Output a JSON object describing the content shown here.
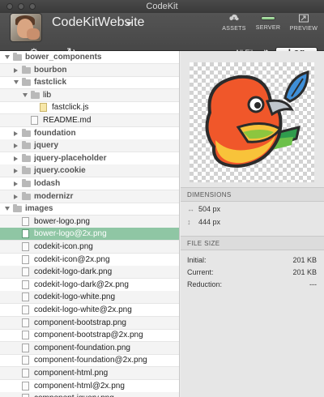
{
  "window": {
    "title": "CodeKit"
  },
  "header": {
    "project_name": "CodeKitWebsite",
    "assets_label": "ASSETS",
    "server_label": "SERVER",
    "preview_label": "PREVIEW",
    "filter_label": "All Files",
    "log_label": "Log"
  },
  "tree": {
    "rows": [
      {
        "label": "bower_components",
        "kind": "folder",
        "state": "open",
        "depth": 0,
        "bold": true
      },
      {
        "label": "bourbon",
        "kind": "folder",
        "state": "closed",
        "depth": 1,
        "bold": true
      },
      {
        "label": "fastclick",
        "kind": "folder",
        "state": "open",
        "depth": 1,
        "bold": true
      },
      {
        "label": "lib",
        "kind": "folder",
        "state": "open",
        "depth": 2,
        "bold": false
      },
      {
        "label": "fastclick.js",
        "kind": "js",
        "depth": 3,
        "bold": false
      },
      {
        "label": "README.md",
        "kind": "file",
        "depth": 2,
        "bold": false
      },
      {
        "label": "foundation",
        "kind": "folder",
        "state": "closed",
        "depth": 1,
        "bold": true
      },
      {
        "label": "jquery",
        "kind": "folder",
        "state": "closed",
        "depth": 1,
        "bold": true
      },
      {
        "label": "jquery-placeholder",
        "kind": "folder",
        "state": "closed",
        "depth": 1,
        "bold": true
      },
      {
        "label": "jquery.cookie",
        "kind": "folder",
        "state": "closed",
        "depth": 1,
        "bold": true
      },
      {
        "label": "lodash",
        "kind": "folder",
        "state": "closed",
        "depth": 1,
        "bold": true
      },
      {
        "label": "modernizr",
        "kind": "folder",
        "state": "closed",
        "depth": 1,
        "bold": true
      },
      {
        "label": "images",
        "kind": "folder",
        "state": "open",
        "depth": 0,
        "bold": true
      },
      {
        "label": "bower-logo.png",
        "kind": "file",
        "depth": 1,
        "bold": false
      },
      {
        "label": "bower-logo@2x.png",
        "kind": "file",
        "depth": 1,
        "bold": false,
        "selected": true
      },
      {
        "label": "codekit-icon.png",
        "kind": "file",
        "depth": 1,
        "bold": false
      },
      {
        "label": "codekit-icon@2x.png",
        "kind": "file",
        "depth": 1,
        "bold": false
      },
      {
        "label": "codekit-logo-dark.png",
        "kind": "file",
        "depth": 1,
        "bold": false
      },
      {
        "label": "codekit-logo-dark@2x.png",
        "kind": "file",
        "depth": 1,
        "bold": false
      },
      {
        "label": "codekit-logo-white.png",
        "kind": "file",
        "depth": 1,
        "bold": false
      },
      {
        "label": "codekit-logo-white@2x.png",
        "kind": "file",
        "depth": 1,
        "bold": false
      },
      {
        "label": "component-bootstrap.png",
        "kind": "file",
        "depth": 1,
        "bold": false
      },
      {
        "label": "component-bootstrap@2x.png",
        "kind": "file",
        "depth": 1,
        "bold": false
      },
      {
        "label": "component-foundation.png",
        "kind": "file",
        "depth": 1,
        "bold": false
      },
      {
        "label": "component-foundation@2x.png",
        "kind": "file",
        "depth": 1,
        "bold": false
      },
      {
        "label": "component-html.png",
        "kind": "file",
        "depth": 1,
        "bold": false
      },
      {
        "label": "component-html@2x.png",
        "kind": "file",
        "depth": 1,
        "bold": false
      },
      {
        "label": "component-jquery.png",
        "kind": "file",
        "depth": 1,
        "bold": false
      }
    ]
  },
  "inspector": {
    "dimensions_title": "DIMENSIONS",
    "width": "504 px",
    "height": "444 px",
    "filesize_title": "FILE SIZE",
    "initial_label": "Initial:",
    "initial_value": "201 KB",
    "current_label": "Current:",
    "current_value": "201 KB",
    "reduction_label": "Reduction:",
    "reduction_value": "---"
  },
  "colors": {
    "selected_row": "#8fc6a4",
    "header_bg": "#4d4d4d"
  }
}
